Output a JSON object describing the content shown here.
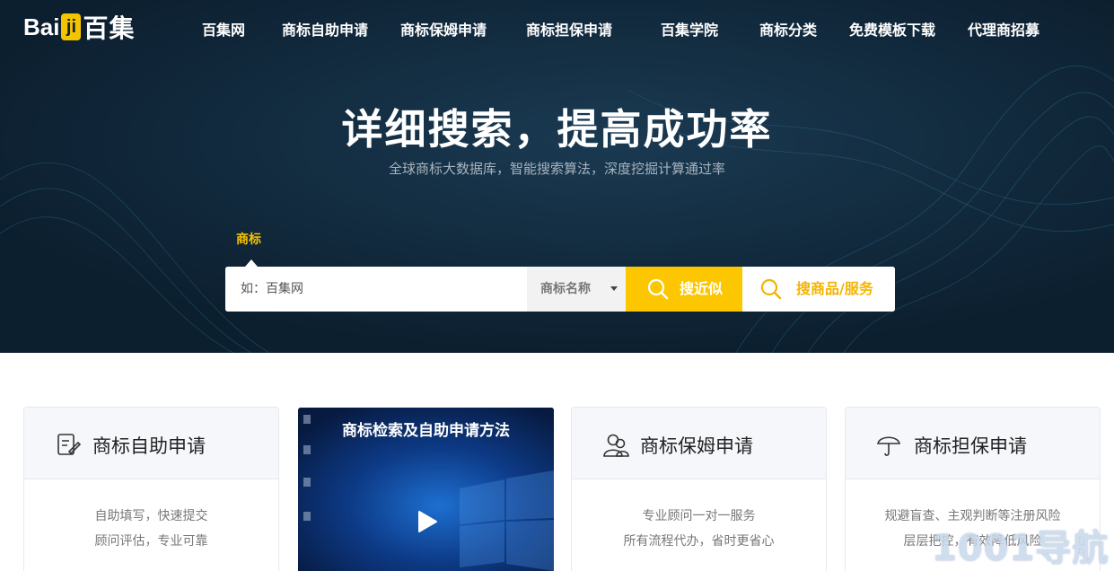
{
  "header": {
    "logo": {
      "latin_prefix": "Bai",
      "latin_badge": "ji",
      "chinese": "百集"
    },
    "nav": [
      {
        "label": "百集网"
      },
      {
        "label": "商标自助申请"
      },
      {
        "label": "商标保姆申请"
      },
      {
        "label": "商标担保申请"
      },
      {
        "label": "百集学院"
      },
      {
        "label": "商标分类"
      },
      {
        "label": "免费模板下载"
      },
      {
        "label": "代理商招募"
      }
    ]
  },
  "hero": {
    "title": "详细搜索，提高成功率",
    "subtitle": "全球商标大数据库，智能搜索算法，深度挖掘计算通过率"
  },
  "search": {
    "active_tab": "商标",
    "placeholder": "如：百集网",
    "select_value": "商标名称",
    "similar_button": "搜近似",
    "goods_button": "搜商品/服务"
  },
  "cards": [
    {
      "icon": "edit-icon",
      "title": "商标自助申请",
      "lines": [
        "自助填写，快速提交",
        "顾问评估，专业可靠"
      ]
    },
    {
      "icon": "users-icon",
      "title": "商标保姆申请",
      "lines": [
        "专业顾问一对一服务",
        "所有流程代办，省时更省心"
      ]
    },
    {
      "icon": "umbrella-icon",
      "title": "商标担保申请",
      "lines": [
        "规避盲查、主观判断等注册风险",
        "层层把控，有效降低风险"
      ]
    }
  ],
  "video": {
    "title": "商标检索及自助申请方法",
    "icon": "play-icon"
  },
  "watermark": "1001导航",
  "colors": {
    "hero_bg": "#0e2334",
    "accent": "#fcc600",
    "card_head": "#f5f7fa"
  }
}
